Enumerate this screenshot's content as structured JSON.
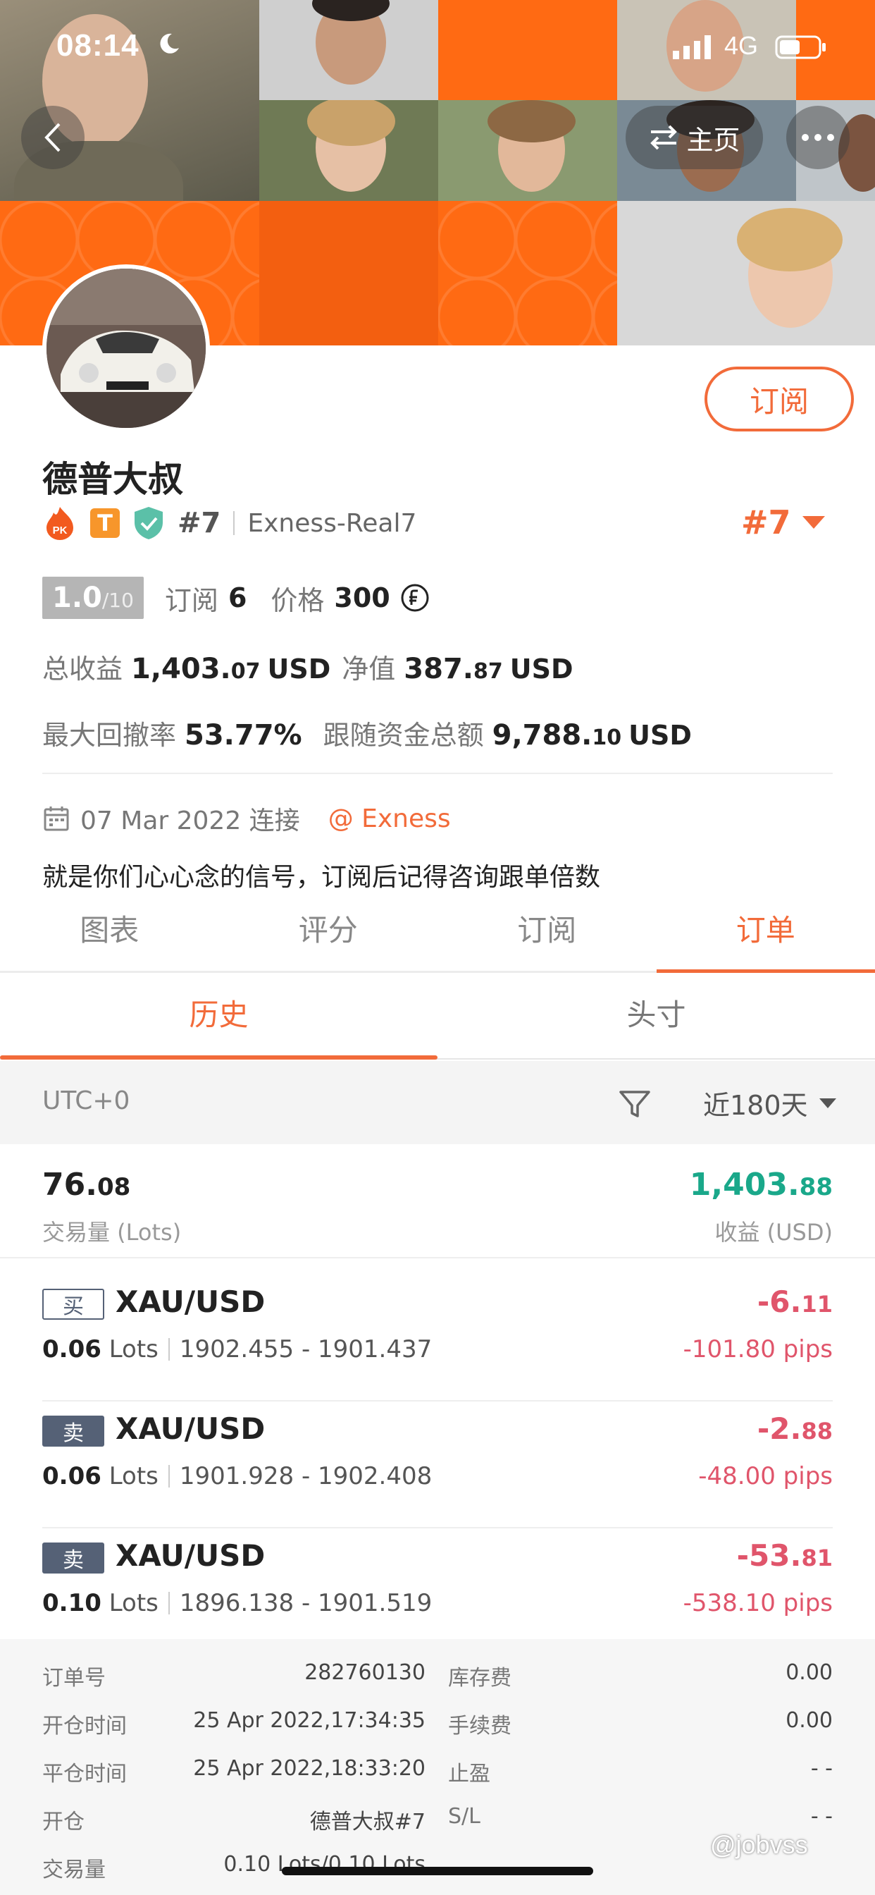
{
  "status_bar": {
    "time": "08:14",
    "network": "4G"
  },
  "header": {
    "home_label": "主页"
  },
  "profile": {
    "subscribe_label": "订阅",
    "name": "德普大叔",
    "rank_small": "#7",
    "server": "Exness-Real7",
    "rank_big": "#7",
    "score_main": "1.0",
    "score_max": "/10",
    "subs_label": "订阅",
    "subs_value": "6",
    "price_label": "价格",
    "price_value": "300",
    "total_profit_label": "总收益",
    "total_profit_int": "1,403.",
    "total_profit_dec": "07",
    "net_value_label": "净值",
    "net_value_int": "387.",
    "net_value_dec": "87",
    "currency": "USD",
    "max_drawdown_label": "最大回撤率",
    "max_drawdown_value": "53.77%",
    "follow_funds_label": "跟随资金总额",
    "follow_funds_int": "9,788.",
    "follow_funds_dec": "10",
    "connected_date": "07 Mar 2022 连接",
    "broker_link": "@ Exness",
    "description": "就是你们心心念的信号，订阅后记得咨询跟单倍数"
  },
  "tabs": [
    "图表",
    "评分",
    "订阅",
    "订单"
  ],
  "subtabs": [
    "历史",
    "头寸"
  ],
  "filter": {
    "timezone": "UTC+0",
    "period": "近180天"
  },
  "summary": {
    "lots_int": "76.",
    "lots_dec": "08",
    "lots_label": "交易量 (Lots)",
    "profit_int": "1,403.",
    "profit_dec": "88",
    "profit_label": "收益 (USD)"
  },
  "trades": [
    {
      "side": "买",
      "symbol": "XAU/USD",
      "lots": "0.06",
      "lots_unit": "Lots",
      "range": "1902.455 - 1901.437",
      "pnl_int": "-6.",
      "pnl_dec": "11",
      "pips": "-101.80 pips"
    },
    {
      "side": "卖",
      "symbol": "XAU/USD",
      "lots": "0.06",
      "lots_unit": "Lots",
      "range": "1901.928 - 1902.408",
      "pnl_int": "-2.",
      "pnl_dec": "88",
      "pips": "-48.00 pips"
    },
    {
      "side": "卖",
      "symbol": "XAU/USD",
      "lots": "0.10",
      "lots_unit": "Lots",
      "range": "1896.138 - 1901.519",
      "pnl_int": "-53.",
      "pnl_dec": "81",
      "pips": "-538.10 pips"
    }
  ],
  "order_details": [
    {
      "label1": "订单号",
      "value1": "282760130",
      "label2": "库存费",
      "value2": "0.00"
    },
    {
      "label1": "开仓时间",
      "value1": "25 Apr 2022,17:34:35",
      "label2": "手续费",
      "value2": "0.00"
    },
    {
      "label1": "平仓时间",
      "value1": "25 Apr 2022,18:33:20",
      "label2": "止盈",
      "value2": "- -"
    },
    {
      "label1": "开仓",
      "value1": "德普大叔#7",
      "label2": "S/L",
      "value2": "- -"
    },
    {
      "label1": "交易量",
      "value1": "0.10 Lots/0.10 Lots",
      "label2": "",
      "value2": ""
    }
  ],
  "watermark": "@jobvss",
  "colors": {
    "accent": "#f26b3a",
    "profit_green": "#1aa88a",
    "loss_red": "#e0556b",
    "side_badge": "#556176"
  }
}
